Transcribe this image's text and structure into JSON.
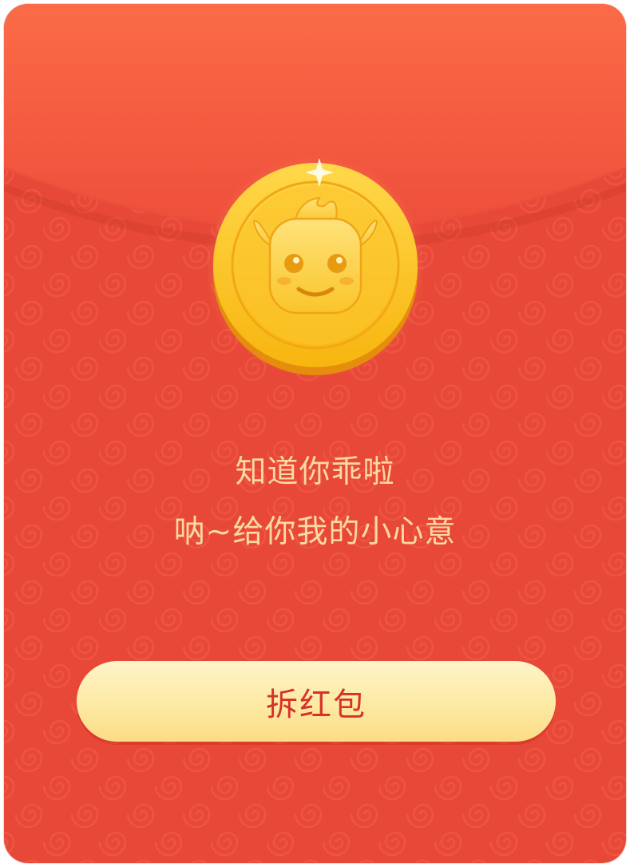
{
  "greeting": {
    "line1": "知道你乖啦",
    "line2": "呐~给你我的小心意"
  },
  "button": {
    "label": "拆红包"
  },
  "icons": {
    "coin": "ox-mascot-coin-icon"
  },
  "colors": {
    "envelope": "#e84837",
    "flap_top": "#f96b47",
    "text": "#fbd9a3",
    "button": "#fde9a3",
    "button_text": "#d6322a",
    "coin": "#f9c21e"
  }
}
